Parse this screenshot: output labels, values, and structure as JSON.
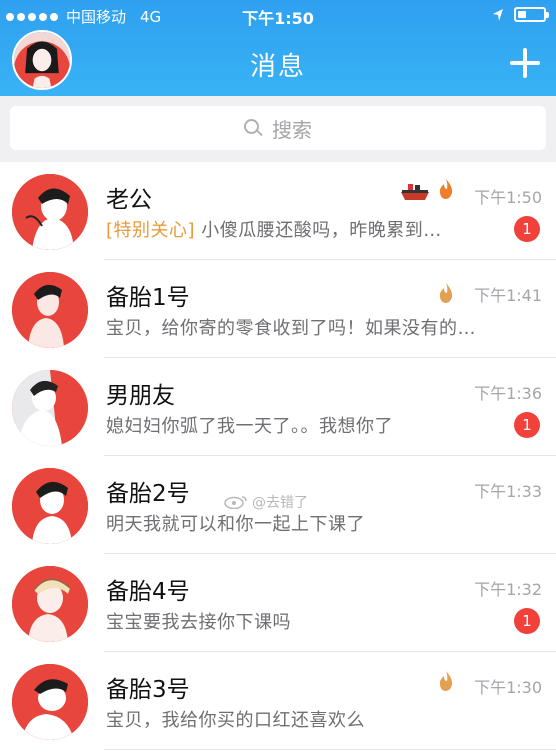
{
  "status_bar": {
    "carrier": "中国移动",
    "network": "4G",
    "time": "下午1:50"
  },
  "nav": {
    "title": "消息"
  },
  "search": {
    "placeholder": "搜索"
  },
  "conversations": [
    {
      "name": "老公",
      "tag": "[特别关心]",
      "preview": "小傻瓜腰还酸吗，昨晚累到…",
      "time": "下午1:50",
      "badge": "1",
      "icons": [
        "ship-icon",
        "flame-icon"
      ]
    },
    {
      "name": "备胎1号",
      "preview": "宝贝，给你寄的零食收到了吗！如果没有的…",
      "time": "下午1:41",
      "icons": [
        "flame-icon"
      ]
    },
    {
      "name": "男朋友",
      "preview": "媳妇妇你弧了我一天了。。我想你了",
      "time": "下午1:36",
      "badge": "1"
    },
    {
      "name": "备胎2号",
      "preview": "明天我就可以和你一起上下课了",
      "time": "下午1:33"
    },
    {
      "name": "备胎4号",
      "preview": "宝宝要我去接你下课吗",
      "time": "下午1:32",
      "badge": "1"
    },
    {
      "name": "备胎3号",
      "preview": "宝贝，我给你买的口红还喜欢么",
      "time": "下午1:30",
      "icons": [
        "flame-icon"
      ]
    }
  ],
  "watermark": "@去错了",
  "colors": {
    "header": "#2fa0f0",
    "badge": "#f2413b",
    "tag": "#e89b3a",
    "avatar_bg": "#e8453c"
  }
}
